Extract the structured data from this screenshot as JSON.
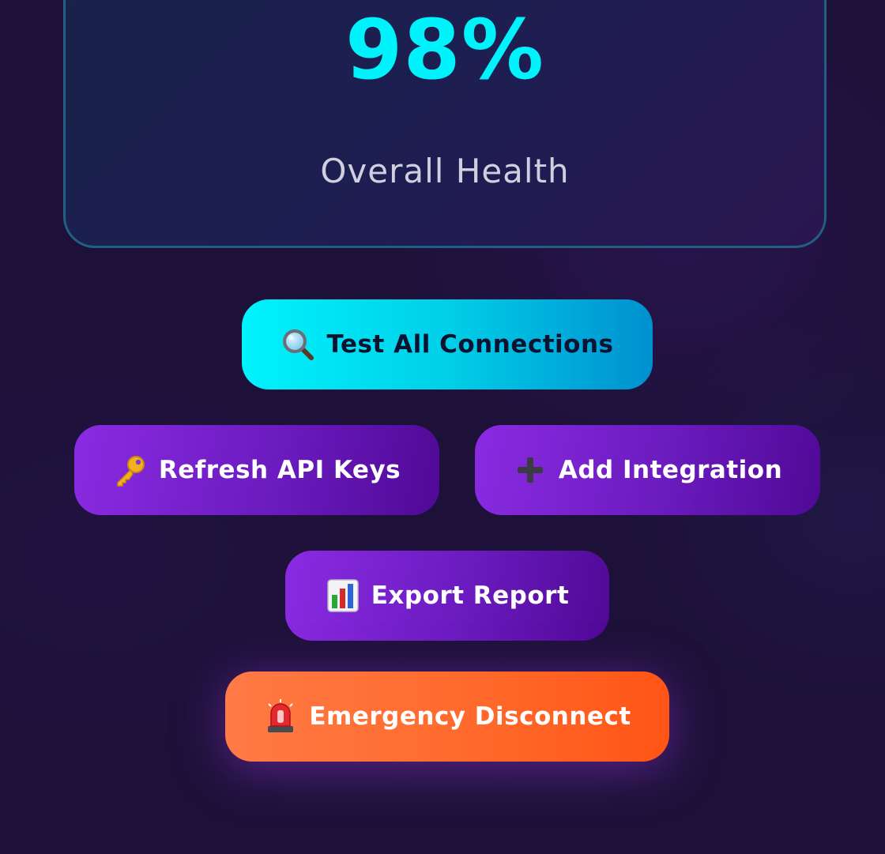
{
  "health": {
    "value": "98%",
    "label": "Overall Health"
  },
  "actions": {
    "test_all": {
      "label": "Test All Connections",
      "icon": "magnifying-glass-icon"
    },
    "refresh_keys": {
      "label": "Refresh API Keys",
      "icon": "key-icon"
    },
    "add_integration": {
      "label": "Add Integration",
      "icon": "plus-icon"
    },
    "export_report": {
      "label": "Export Report",
      "icon": "bar-chart-icon"
    },
    "emergency_disconnect": {
      "label": "Emergency Disconnect",
      "icon": "siren-icon"
    }
  },
  "colors": {
    "background": "#1d1139",
    "accent_cyan": "#00f2fb",
    "card_border": "#1f6083",
    "purple": "#8a2be2",
    "danger_orange": "#ff6a2c"
  }
}
